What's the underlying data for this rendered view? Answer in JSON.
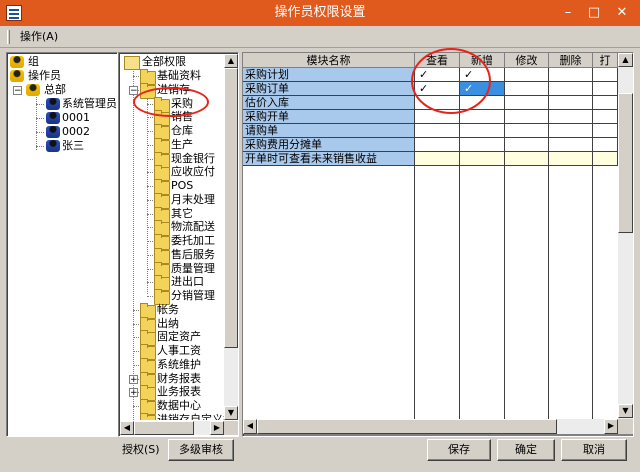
{
  "window": {
    "title": "操作员权限设置",
    "minimize": "–",
    "maximize": "□",
    "close": "✕"
  },
  "menu": {
    "ops": "操作(A)"
  },
  "left_tree": {
    "items": [
      {
        "label": "组",
        "icon": "user-group-icon"
      },
      {
        "label": "操作员",
        "icon": "operator-icon"
      },
      {
        "label": "总部",
        "icon": "headquarters-icon"
      },
      {
        "label": "系统管理员",
        "icon": "admin-user-icon"
      },
      {
        "label": "0001",
        "icon": "user-icon"
      },
      {
        "label": "0002",
        "icon": "user-icon"
      },
      {
        "label": "张三",
        "icon": "user-icon"
      }
    ]
  },
  "perm_tree": {
    "root": "全部权限",
    "items": [
      "基础资料",
      "进销存",
      "采购",
      "销售",
      "仓库",
      "生产",
      "现金银行",
      "应收应付",
      "POS",
      "月末处理",
      "其它",
      "物流配送",
      "委托加工",
      "售后服务",
      "质量管理",
      "进出口",
      "分销管理",
      "帐务",
      "出纳",
      "固定资产",
      "人事工资",
      "系统维护",
      "财务报表",
      "业务报表",
      "数据中心",
      "进销存自定义报"
    ]
  },
  "grid": {
    "headers": [
      "模块名称",
      "查看",
      "新增",
      "修改",
      "删除",
      "打"
    ],
    "rows": [
      {
        "module": "采购计划",
        "view": "✓",
        "add": "✓"
      },
      {
        "module": "采购订单",
        "view": "✓",
        "add": "✓"
      },
      {
        "module": "估价入库",
        "view": "",
        "add": ""
      },
      {
        "module": "采购开单",
        "view": "",
        "add": ""
      },
      {
        "module": "请购单",
        "view": "",
        "add": ""
      },
      {
        "module": "采购费用分摊单",
        "view": "",
        "add": ""
      },
      {
        "module": "开单时可查看未来销售收益",
        "view": "",
        "add": ""
      }
    ]
  },
  "bottom": {
    "grant_label": "授权(S)",
    "multi_review": "多级审核",
    "save": "保存",
    "confirm": "确定",
    "cancel": "取消"
  },
  "colors": {
    "title_bar": "#e05a1e",
    "annotation": "#e8231c",
    "module_cell": "#a8c8ec",
    "selected": "#3a8fe0"
  }
}
